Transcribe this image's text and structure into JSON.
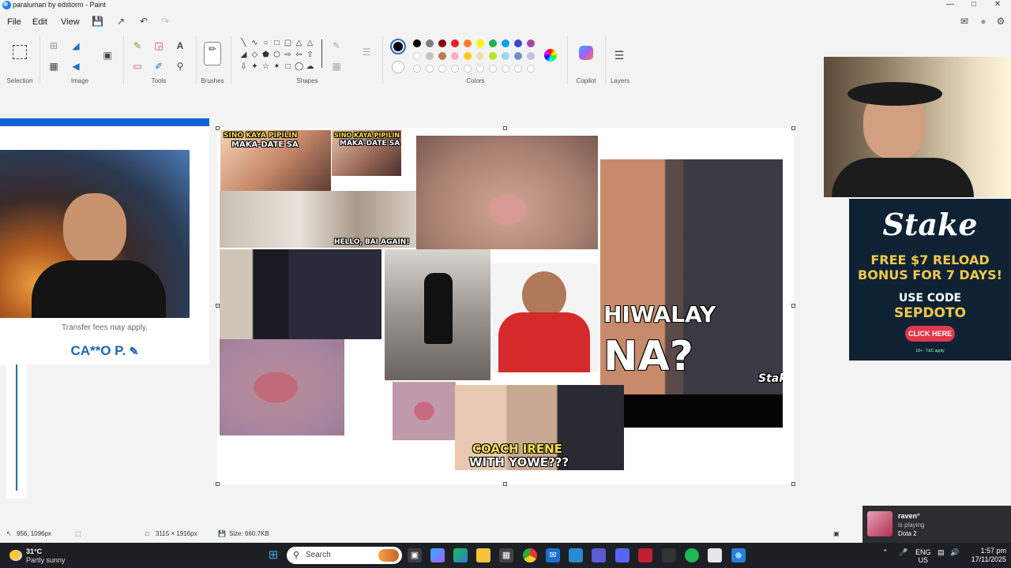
{
  "window": {
    "title": "paraluman by edstorm - Paint",
    "controls": {
      "minimize": "—",
      "maximize": "□",
      "close": "✕"
    }
  },
  "menu": {
    "items": [
      "File",
      "Edit",
      "View"
    ]
  },
  "ribbon": {
    "groups": {
      "selection": "Selection",
      "image": "Image",
      "tools": "Tools",
      "brushes": "Brushes",
      "shapes": "Shapes",
      "colors": "Colors",
      "copilot": "Copilot",
      "layers": "Layers"
    },
    "palette_row1": [
      "#000000",
      "#7f7f7f",
      "#880015",
      "#ed1c24",
      "#ff7f27",
      "#fff200",
      "#22b14c",
      "#00a2e8",
      "#3f48cc",
      "#a349a4"
    ],
    "palette_row2": [
      "#ffffff",
      "#c3c3c3",
      "#b97a57",
      "#ffaec9",
      "#ffc90e",
      "#efe4b0",
      "#b5e61d",
      "#99d9ea",
      "#7092be",
      "#c8bfe7"
    ],
    "primary_color": "#000000",
    "secondary_color": "#ffffff"
  },
  "stream_overlay": {
    "fees_text": "Transfer fees may apply.",
    "name_text": "CA**O P."
  },
  "canvas_images": {
    "top_left_a_title": "SINO KAYA PIPILIN",
    "top_left_a_sub": "MAKA-DATE SA",
    "top_left_b_title": "SINO KAYA PIPILIN",
    "top_left_b_sub": "MAKA-DATE SA",
    "collage_caption": "HELLO, BAI AGAIN!",
    "thumb_big_1": "HIWALAY",
    "thumb_big_2": "NA?",
    "thumb_brand": "Stake",
    "bottom_caption_1": "COACH IRENE",
    "bottom_caption_2": "WITH YOWE???"
  },
  "ad": {
    "brand": "Stake",
    "promo": "FREE $7 RELOAD BONUS FOR 7 DAYS!",
    "use_code": "USE CODE",
    "code": "SEPDOTO",
    "cta": "CLICK HERE",
    "disclaimer": "18+ · T&C apply"
  },
  "statusbar": {
    "cursor_pos": "956, 1096px",
    "canvas_size": "3115 × 1916px",
    "file_size": "Size: 660.7KB"
  },
  "notification": {
    "user": "raven°",
    "status": "is playing",
    "game": "Dota 2"
  },
  "taskbar": {
    "weather_temp": "31°C",
    "weather_cond": "Partly sunny",
    "search_placeholder": "Search",
    "lang_1": "ENG",
    "lang_2": "US",
    "time": "1:57 pm",
    "date": "17/11/2025"
  }
}
